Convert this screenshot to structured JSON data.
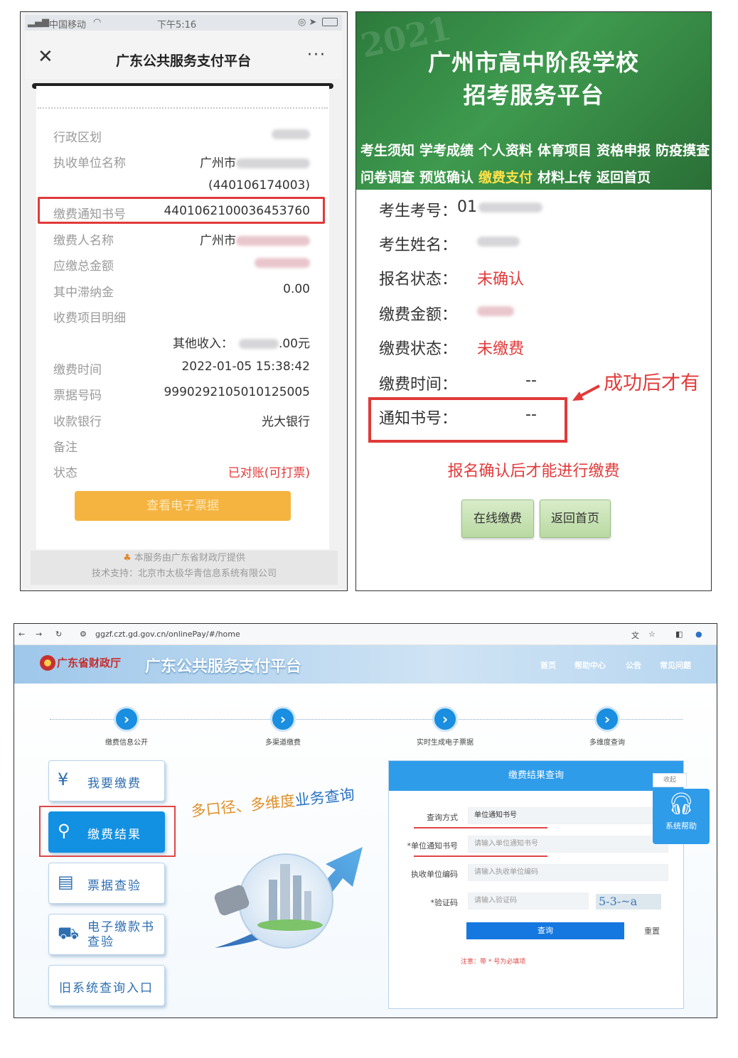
{
  "phone": {
    "status": {
      "carrier": "中国移动",
      "time": "下午5:16"
    },
    "nav": {
      "title": "广东公共服务支付平台",
      "close": "✕",
      "more": "···"
    },
    "rows": {
      "region": {
        "label": "行政区划"
      },
      "unit": {
        "label": "执收单位名称",
        "value_prefix": "广州市",
        "code": "(440106174003)"
      },
      "notice": {
        "label": "缴费通知书号",
        "value": "4401062100036453760"
      },
      "payer": {
        "label": "缴费人名称",
        "value_prefix": "广州市"
      },
      "total": {
        "label": "应缴总金额"
      },
      "late": {
        "label": "其中滞纳金",
        "value": "0.00"
      },
      "items": {
        "label": "收费项目明细"
      },
      "other": {
        "label": "其他收入：",
        "suffix": ".00元"
      },
      "time": {
        "label": "缴费时间",
        "value": "2022-01-05 15:38:42"
      },
      "bill": {
        "label": "票据号码",
        "value": "9990292105010125005"
      },
      "bank": {
        "label": "收款银行",
        "value": "光大银行"
      },
      "remark": {
        "label": "备注"
      },
      "state": {
        "label": "状态",
        "value": "已对账(可打票)"
      }
    },
    "button": "查看电子票据",
    "footer": {
      "line1": "本服务由广东省财政厅提供",
      "line2": "技术支持：北京市太极华青信息系统有限公司"
    }
  },
  "exam": {
    "year": "2021",
    "title_line1": "广州市高中阶段学校",
    "title_line2": "招考服务平台",
    "menu_row1": [
      "考生须知",
      "学考成绩",
      "个人资料",
      "体育项目",
      "资格申报",
      "防疫摸查"
    ],
    "menu_row2": [
      "问卷调查",
      "预览确认",
      "缴费支付",
      "材料上传",
      "返回首页"
    ],
    "fields": {
      "exam_no": {
        "label": "考生考号：",
        "value": "01"
      },
      "name": {
        "label": "考生姓名：",
        "value": ""
      },
      "reg": {
        "label": "报名状态：",
        "value": "未确认"
      },
      "amount": {
        "label": "缴费金额："
      },
      "pay_state": {
        "label": "缴费状态：",
        "value": "未缴费"
      },
      "pay_time": {
        "label": "缴费时间：",
        "value": "--"
      },
      "notice": {
        "label": "通知书号：",
        "value": "--"
      }
    },
    "annotation": "成功后才有",
    "warning": "报名确认后才能进行缴费",
    "buttons": {
      "pay": "在线缴费",
      "home": "返回首页"
    }
  },
  "portal": {
    "url": "ggzf.czt.gd.gov.cn/onlinePay/#/home",
    "org": "广东省财政厅",
    "platform": "广东公共服务支付平台",
    "nav": [
      "首页",
      "帮助中心",
      "公告",
      "常见问题"
    ],
    "steps": [
      "缴费信息公开",
      "多渠道缴费",
      "实时生成电子票据",
      "多维度查询"
    ],
    "side": [
      "我要缴费",
      "缴费结果",
      "票据查验",
      "电子缴款书查验",
      "旧系统查询入口"
    ],
    "slogan_a": "多口径、多维度",
    "slogan_b": "业务查询",
    "form": {
      "title": "缴费结果查询",
      "method_label": "查询方式",
      "method_value": "单位通知书号",
      "notice_label": "*单位通知书号",
      "notice_placeholder": "请输入单位通知书号",
      "unit_label": "执收单位编码",
      "unit_placeholder": "请输入执收单位编码",
      "code_label": "*验证码",
      "code_placeholder": "请输入验证码",
      "captcha": "5-3-~a",
      "query": "查询",
      "reset": "重置",
      "note": "注意：带 * 号为必填项"
    },
    "help": "系统帮助",
    "fold": "收起"
  }
}
